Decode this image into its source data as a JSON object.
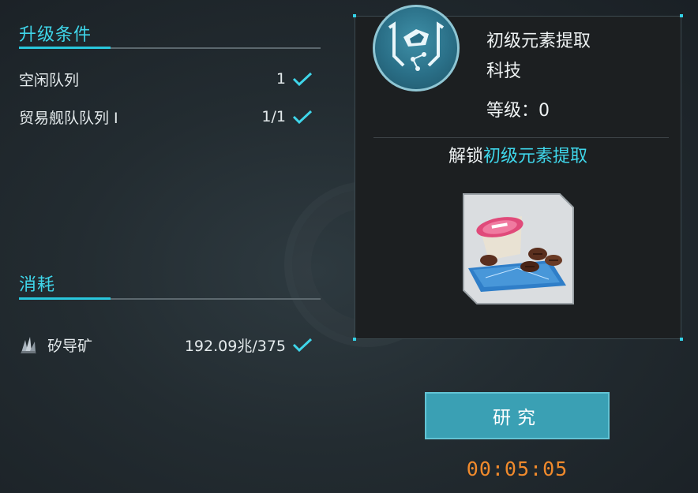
{
  "requirements": {
    "title": "升级条件",
    "rows": [
      {
        "name": "空闲队列",
        "value": "1"
      },
      {
        "name": "贸易舰队队列 I",
        "value": "1/1"
      }
    ]
  },
  "consumption": {
    "title": "消耗",
    "rows": [
      {
        "name": "矽导矿",
        "value": "192.09兆/375",
        "icon": "crystal-ore-icon"
      }
    ]
  },
  "tech": {
    "name_line1": "初级元素提取",
    "name_line2": "科技",
    "level": "等级：0",
    "icon": "element-extraction-icon"
  },
  "unlock": {
    "prefix": "解锁",
    "highlight": "初级元素提取",
    "item_icon": "coffee-capsule-item-icon"
  },
  "action": {
    "button_label": "研究",
    "timer": "00:05:05"
  },
  "colors": {
    "accent": "#3fd6ea",
    "button": "#3aa0b4",
    "timer": "#f08a2c"
  }
}
